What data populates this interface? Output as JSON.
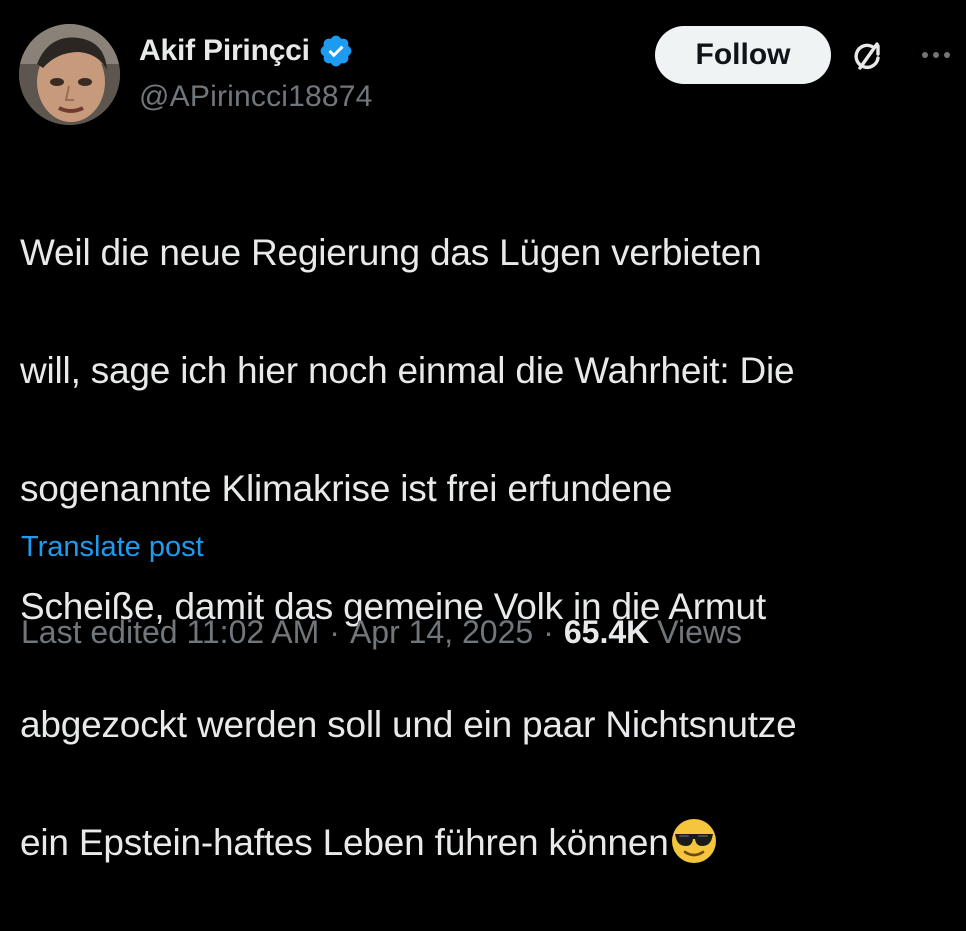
{
  "author": {
    "display_name": "Akif Pirinçci",
    "handle": "@APirincci18874",
    "verified": true
  },
  "actions": {
    "follow_label": "Follow"
  },
  "icons": {
    "verified": "verified-badge-icon",
    "grok": "grok-icon",
    "more": "more-icon",
    "emoji": "smiling-face-with-sunglasses"
  },
  "post": {
    "lines": [
      "Weil die neue Regierung das Lügen verbieten",
      "will, sage ich hier noch einmal die Wahrheit: Die",
      "sogenannte Klimakrise ist frei erfundene",
      "Scheiße, damit das gemeine Volk in die Armut",
      "abgezockt werden soll und ein paar Nichtsnutze",
      "ein Epstein-haftes Leben führen können"
    ],
    "translate_label": "Translate post"
  },
  "meta": {
    "edited": "Last edited 11:02 AM",
    "separator": "·",
    "date": "Apr 14, 2025",
    "views_count": "65.4K",
    "views_label": "Views"
  },
  "colors": {
    "background": "#000000",
    "text": "#e7e9ea",
    "secondary": "#71767b",
    "link": "#1d9bf0",
    "verified": "#1d9bf0",
    "follow_bg": "#eff3f4"
  }
}
